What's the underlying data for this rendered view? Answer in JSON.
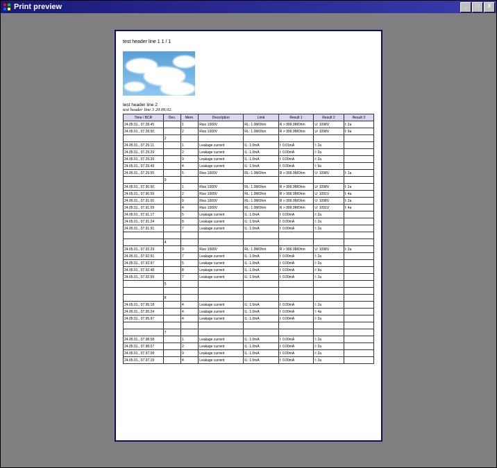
{
  "window": {
    "title": "Print preview",
    "buttons": {
      "min": "_",
      "max": "□",
      "close": "X"
    }
  },
  "page": {
    "header1": "test header line 1    1 / 1",
    "header2": "test header line 2",
    "header3": "test header line 3   20.09.02.",
    "columns": [
      "Time / BCR",
      "Dev.",
      "Mem.",
      "Description",
      "Limit",
      "Result 1",
      "Result 2",
      "Result 3"
    ]
  },
  "rows": [
    {
      "time": "24.05.01., 07.28.45",
      "dev": "",
      "mem": "1",
      "desc": "Riso 1000V",
      "lim": "RL: 1.0MOhm",
      "r1": "R > 999.9MOhm",
      "r2": "U: 1098V",
      "r3": "I: 2a"
    },
    {
      "time": "24.05.01., 07.28.50",
      "dev": "",
      "mem": "2",
      "desc": "Riso 1000V",
      "lim": "RL: 1.0MOhm",
      "r1": "R > 999.9MOhm",
      "r2": "U: 1098V",
      "r3": "I: 9a"
    },
    {
      "time": "",
      "dev": "2",
      "mem": "",
      "desc": "",
      "lim": "",
      "r1": "",
      "r2": "",
      "r3": ""
    },
    {
      "time": "24.05.01., 07.29.11",
      "dev": "",
      "mem": "1",
      "desc": "Leakage current",
      "lim": "IL: 1.0mA",
      "r1": "I: 0.01mA",
      "r2": "I: 2a",
      "r3": ""
    },
    {
      "time": "24.05.01., 07.29.29",
      "dev": "",
      "mem": "2",
      "desc": "Leakage current",
      "lim": "IL: 1.0mA",
      "r1": "I: 0.00mA",
      "r2": "I: 2a",
      "r3": ""
    },
    {
      "time": "24.05.01., 07.29.39",
      "dev": "",
      "mem": "9",
      "desc": "Leakage current",
      "lim": "IL: 1.0mA",
      "r1": "I: 0.00mA",
      "r2": "I: 2a",
      "r3": ""
    },
    {
      "time": "24.05.01., 07.29.49",
      "dev": "",
      "mem": "4",
      "desc": "Leakage current",
      "lim": "IL: 1.0mA",
      "r1": "I: 0.00mA",
      "r2": "I: 9a",
      "r3": ""
    },
    {
      "time": "24.05.01., 07.29.55",
      "dev": "",
      "mem": "5",
      "desc": "Riso 1000V",
      "lim": "RL: 1.0MOhm",
      "r1": "R > 999.9MOhm",
      "r2": "U: 1098V",
      "r3": "I: 1a"
    },
    {
      "time": "",
      "dev": "9",
      "mem": "",
      "desc": "",
      "lim": "",
      "r1": "",
      "r2": "",
      "r3": ""
    },
    {
      "time": "24.05.01., 07.90.50",
      "dev": "",
      "mem": "1",
      "desc": "Riso 1000V",
      "lim": "RL: 1.0MOhm",
      "r1": "R > 999.9MOhm",
      "r2": "U: 1098V",
      "r3": "I: 2a"
    },
    {
      "time": "24.05.01., 07.90.59",
      "dev": "",
      "mem": "2",
      "desc": "Riso 1000V",
      "lim": "RL: 1.0MOhm",
      "r1": "R > 999.9MOhm",
      "r2": "U: 1091V",
      "r3": "I: 4a"
    },
    {
      "time": "24.05.01., 07.91.00",
      "dev": "",
      "mem": "9",
      "desc": "Riso 1000V",
      "lim": "RL: 1.0MOhm",
      "r1": "R > 999.9MOhm",
      "r2": "U: 1098V",
      "r3": "I: 2a"
    },
    {
      "time": "24.05.01., 07.91.09",
      "dev": "",
      "mem": "4",
      "desc": "Riso 1000V",
      "lim": "RL: 1.0MOhm",
      "r1": "R > 999.9MOhm",
      "r2": "U: 1091V",
      "r3": "I: 4a"
    },
    {
      "time": "24.05.01., 07.91.17",
      "dev": "",
      "mem": "5",
      "desc": "Leakage current",
      "lim": "IL: 1.0mA",
      "r1": "I: 0.00mA",
      "r2": "I: 2a",
      "r3": ""
    },
    {
      "time": "24.05.01., 07.91.24",
      "dev": "",
      "mem": "8",
      "desc": "Leakage current",
      "lim": "IL: 1.0mA",
      "r1": "I: 0.00mA",
      "r2": "I: 2a",
      "r3": ""
    },
    {
      "time": "24.05.01., 07.91.91",
      "dev": "",
      "mem": "7",
      "desc": "Leakage current",
      "lim": "IL: 1.0mA",
      "r1": "I: 0.00mA",
      "r2": "I: 2a",
      "r3": ""
    },
    {
      "time": "",
      "dev": "",
      "mem": "",
      "desc": "",
      "lim": "",
      "r1": "",
      "r2": "",
      "r3": ""
    },
    {
      "time": "",
      "dev": "4",
      "mem": "",
      "desc": "",
      "lim": "",
      "r1": "",
      "r2": "",
      "r3": ""
    },
    {
      "time": "24.05.01., 07.92.29",
      "dev": "",
      "mem": "9",
      "desc": "Riso 1000V",
      "lim": "RL: 1.0MOhm",
      "r1": "R > 999.9MOhm",
      "r2": "U: 1098V",
      "r3": "I: 2a"
    },
    {
      "time": "24.05.01., 07.92.91",
      "dev": "",
      "mem": "7",
      "desc": "Leakage current",
      "lim": "IL: 1.0mA",
      "r1": "I: 0.00mA",
      "r2": "I: 2a",
      "r3": ""
    },
    {
      "time": "24.05.01., 07.92.97",
      "dev": "",
      "mem": "5",
      "desc": "Leakage current",
      "lim": "IL: 1.0mA",
      "r1": "I: 0.00mA",
      "r2": "I: 2a",
      "r3": ""
    },
    {
      "time": "24.05.01., 07.92.48",
      "dev": "",
      "mem": "8",
      "desc": "Leakage current",
      "lim": "IL: 1.0mA",
      "r1": "I: 0.00mA",
      "r2": "I: 9a",
      "r3": ""
    },
    {
      "time": "24.05.01., 07.92.59",
      "dev": "",
      "mem": "7",
      "desc": "Leakage current",
      "lim": "IL: 1.0mA",
      "r1": "I: 0.00mA",
      "r2": "I: 2a",
      "r3": ""
    },
    {
      "time": "",
      "dev": "5",
      "mem": "",
      "desc": "",
      "lim": "",
      "r1": "",
      "r2": "",
      "r3": ""
    },
    {
      "time": "",
      "dev": "",
      "mem": "",
      "desc": "",
      "lim": "",
      "r1": "",
      "r2": "",
      "r3": ""
    },
    {
      "time": "",
      "dev": "8",
      "mem": "",
      "desc": "",
      "lim": "",
      "r1": "",
      "r2": "",
      "r3": ""
    },
    {
      "time": "24.05.01., 07.95.18",
      "dev": "",
      "mem": "4",
      "desc": "Leakage current",
      "lim": "IL: 1.0mA",
      "r1": "I: 0.00mA",
      "r2": "I: 2a",
      "r3": ""
    },
    {
      "time": "24.05.01., 07.95.24",
      "dev": "",
      "mem": "4",
      "desc": "Leakage current",
      "lim": "IL: 1.0mA",
      "r1": "I: 0.00mA",
      "r2": "I: 4a",
      "r3": ""
    },
    {
      "time": "24.05.01., 07.95.97",
      "dev": "",
      "mem": "4",
      "desc": "Leakage current",
      "lim": "IL: 1.0mA",
      "r1": "I: 0.00mA",
      "r2": "I: 2a",
      "r3": ""
    },
    {
      "time": "",
      "dev": "",
      "mem": "",
      "desc": "",
      "lim": "",
      "r1": "",
      "r2": "",
      "r3": ""
    },
    {
      "time": "",
      "dev": "7",
      "mem": "",
      "desc": "",
      "lim": "",
      "r1": "",
      "r2": "",
      "r3": ""
    },
    {
      "time": "24.05.01., 07.98.58",
      "dev": "",
      "mem": "1",
      "desc": "Leakage current",
      "lim": "IL: 1.0mA",
      "r1": "I: 0.00mA",
      "r2": "I: 2a",
      "r3": ""
    },
    {
      "time": "24.05.01., 07.98.07",
      "dev": "",
      "mem": "2",
      "desc": "Leakage current",
      "lim": "IL: 1.0mA",
      "r1": "I: 0.00mA",
      "r2": "I: 2a",
      "r3": ""
    },
    {
      "time": "24.05.01., 07.97.08",
      "dev": "",
      "mem": "9",
      "desc": "Leakage current",
      "lim": "IL: 1.0mA",
      "r1": "I: 0.00mA",
      "r2": "I: 2a",
      "r3": ""
    },
    {
      "time": "24.05.01., 07.97.19",
      "dev": "",
      "mem": "4",
      "desc": "Leakage current",
      "lim": "IL: 1.0mA",
      "r1": "I: 0.00mA",
      "r2": "I: 2a",
      "r3": ""
    }
  ]
}
